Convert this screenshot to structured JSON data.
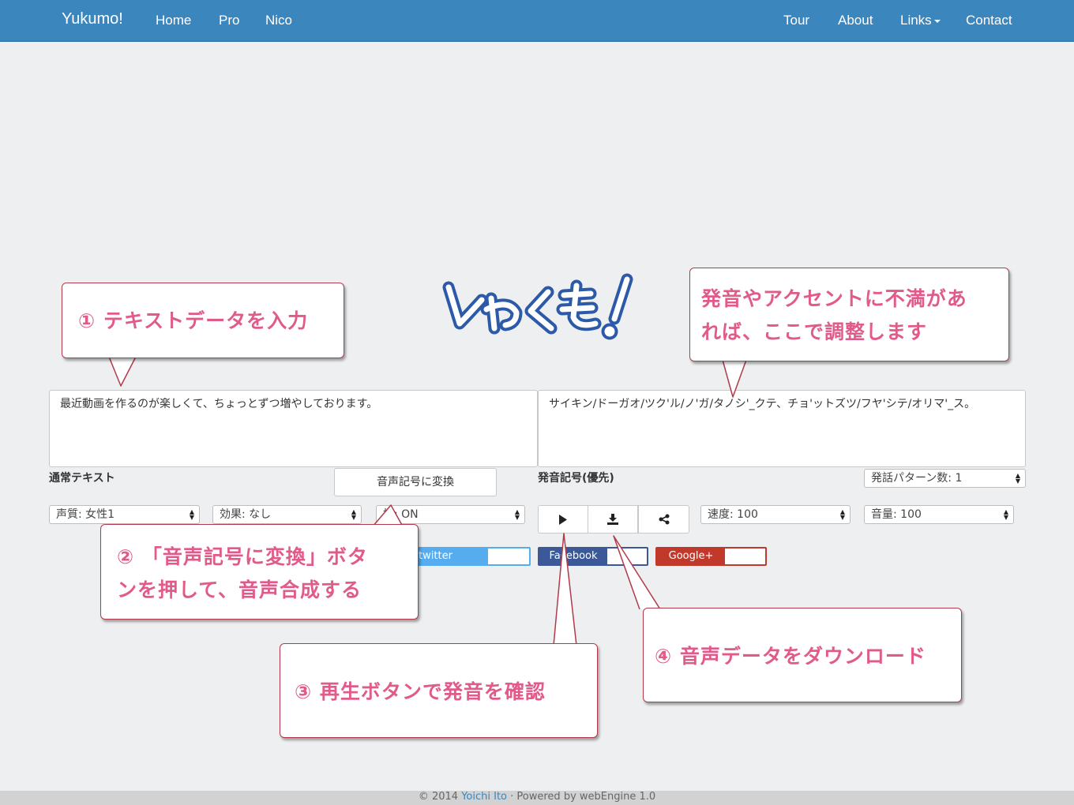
{
  "navbar": {
    "brand": "Yukumo!",
    "left_links": [
      "Home",
      "Pro",
      "Nico"
    ],
    "right_links": [
      "Tour",
      "About",
      "Links",
      "Contact"
    ]
  },
  "input": {
    "text": "最近動画を作るのが楽しくて、ちょっとずつ増やしております。",
    "label": "通常テキスト"
  },
  "pronunciation": {
    "text": "サイキン/ドーガオ/ツク'ル/ノ'ガ/タノシ'_クテ、チョ'ットズツ/フヤ'シテ/オリマ'_ス。",
    "label": "発音記号(優先)"
  },
  "convert_button": "音声記号に変換",
  "selects": {
    "voice": "声質: 女性1",
    "effect": "効果: なし",
    "intonation": "揚: ON",
    "pattern": "発話パターン数: 1",
    "speed": "速度: 100",
    "volume": "音量: 100"
  },
  "player_icons": [
    "play-icon",
    "download-icon",
    "share-icon"
  ],
  "share_buttons": {
    "twitter": "twitter",
    "facebook": "Facebook",
    "google": "Google+"
  },
  "callouts": {
    "c1": "① テキストデータを入力",
    "c2_line1": "② 「音声記号に変換」ボタ",
    "c2_line2": "ンを押して、音声合成する",
    "c3": "③ 再生ボタンで発音を確認",
    "c4": "④ 音声データをダウンロード",
    "c5_line1": "発音やアクセントに不満があ",
    "c5_line2": "れば、ここで調整します"
  },
  "footer": {
    "prefix": "© 2014 ",
    "author": "Yoichi Ito",
    "suffix": " · Powered by webEngine 1.0"
  },
  "colors": {
    "navbar": "#3b86bd",
    "callout_text": "#e05a8a",
    "callout_border": "#b23a4a",
    "twitter": "#55acee",
    "facebook": "#3b5998",
    "google": "#c0392b"
  }
}
